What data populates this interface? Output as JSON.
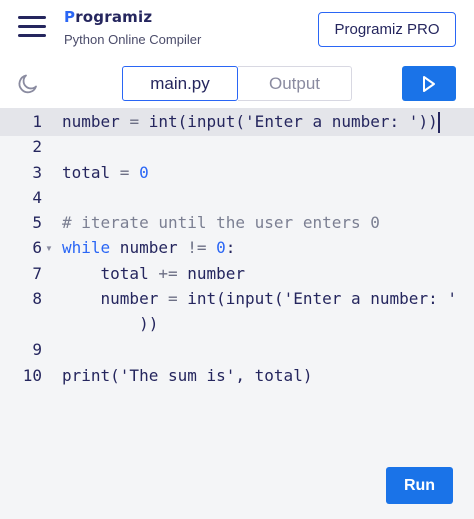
{
  "header": {
    "logo_text": "rogramiz",
    "logo_letter": "P",
    "subtitle": "Python Online Compiler",
    "pro_button_label": "Programiz PRO"
  },
  "toolbar": {
    "theme_icon": "moon-icon",
    "tabs": [
      {
        "label": "main.py",
        "active": true
      },
      {
        "label": "Output",
        "active": false
      }
    ],
    "run_icon": "play-icon"
  },
  "editor": {
    "line_numbers": [
      "1",
      "2",
      "3",
      "4",
      "5",
      "6",
      "7",
      "8",
      "9",
      "10"
    ],
    "lines": [
      "number = int(input('Enter a number: '))",
      "",
      "total = 0",
      "",
      "# iterate until the user enters 0",
      "while number != 0:",
      "    total += number",
      "    number = int(input('Enter a number: '",
      "        ))",
      "",
      "print('The sum is', total)"
    ]
  },
  "run_button_label": "Run",
  "colors": {
    "accent": "#1a73e8",
    "brand_dark": "#25265e",
    "editor_bg": "#f4f5f7"
  }
}
